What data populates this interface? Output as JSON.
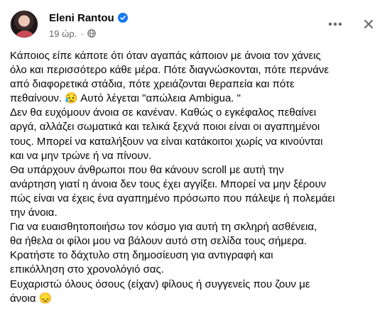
{
  "post": {
    "author": "Eleni Rantou",
    "time": "19 ώρ.",
    "separator": "·",
    "icons": {
      "verified": "verified-badge-icon",
      "audience": "globe-icon",
      "more": "more-options-icon",
      "close": "close-icon"
    },
    "colors": {
      "verified": "#1877f2",
      "meta": "#65676b",
      "text": "#050505"
    },
    "lines": [
      "Κάποιος είπε κάποτε ότι όταν αγαπάς κάποιον με άνοια τον χάνεις",
      "όλο και περισσότερο κάθε μέρα. Πότε διαγνώσκονται, πότε περνάνε",
      "από διαφορετικά στάδια, πότε χρειάζονται θεραπεία και πότε",
      "πεθαίνουν. 😥 Αυτό λέγεται \"απώλεια Ambigua. \"",
      "Δεν θα ευχόμουν άνοια σε κανέναν. Καθώς ο εγκέφαλος πεθαίνει",
      "αργά, αλλάζει σωματικά και τελικά ξεχνά ποιοι είναι οι αγαπημένοι",
      "τους. Μπορεί να καταλήξουν να είναι κατάκοιτοι χωρίς να κινούνται",
      "και να μην τρώνε ή να πίνουν.",
      "Θα υπάρχουν άνθρωποι που θα κάνουν scroll με αυτή την",
      "ανάρτηση γιατί η άνοια δεν τους έχει αγγίξει. Μπορεί να μην ξέρουν",
      "πώς είναι να έχεις ένα αγαπημένο πρόσωπο που πάλεψε ή πολεμάει",
      "την άνοια.",
      "Για να ευαισθητοποιήσω τον κόσμο για αυτή τη σκληρή ασθένεια,",
      "θα ήθελα οι φίλοι μου να βάλουν αυτό στη σελίδα τους σήμερα.",
      "Κρατήστε το δάχτυλο στη δημοσίευση για αντιγραφή και",
      "επικόλληση στο χρονολόγιό σας.",
      "Ευχαριστώ όλους όσους (είχαν) φίλους ή συγγενείς που ζουν με",
      "άνοια 😞"
    ]
  }
}
